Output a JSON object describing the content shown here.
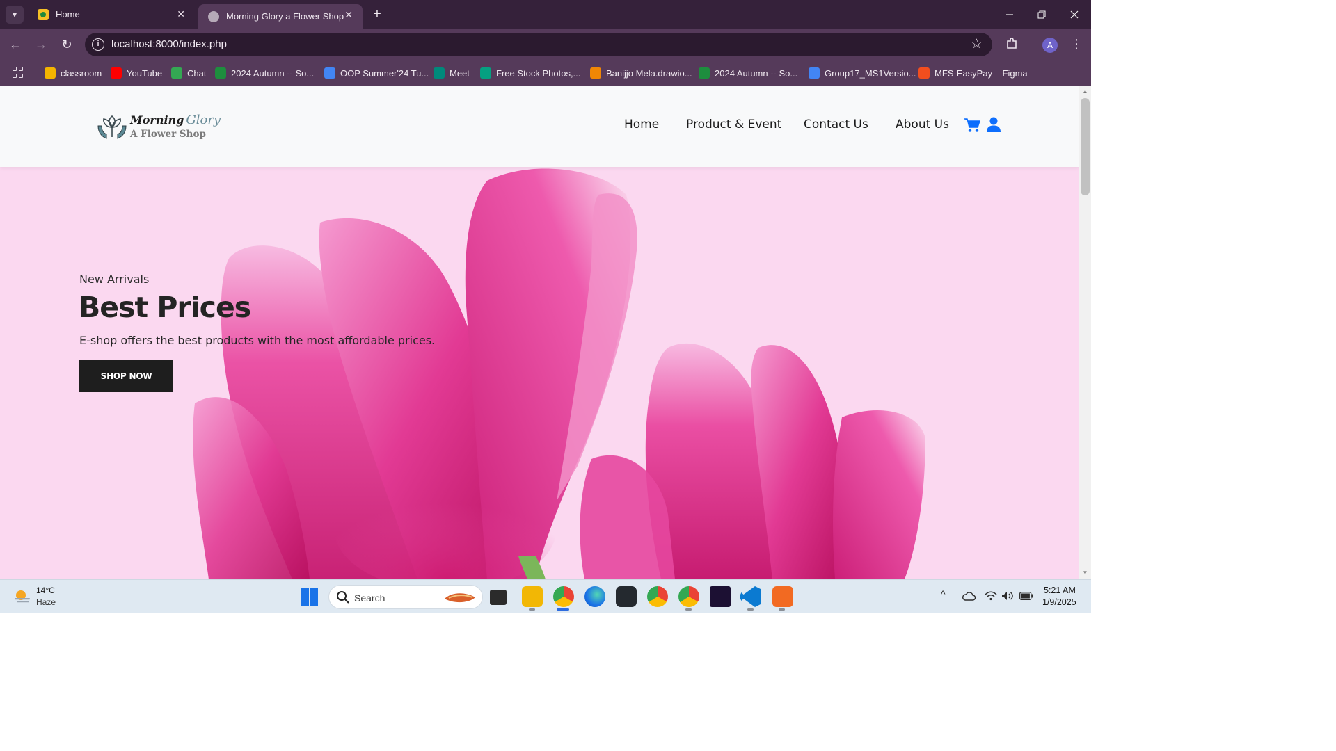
{
  "browser": {
    "tabs": [
      {
        "title": "Home",
        "active": false
      },
      {
        "title": "Morning Glory a Flower Shop",
        "active": true
      }
    ],
    "url": "localhost:8000/index.php",
    "profile_initial": "A",
    "bookmarks": [
      {
        "label": "classroom",
        "icon": "classroom-icon",
        "color": "#f4b400"
      },
      {
        "label": "YouTube",
        "icon": "youtube-icon",
        "color": "#ff0000"
      },
      {
        "label": "Chat",
        "icon": "google-chat-icon",
        "color": "#34a853"
      },
      {
        "label": "2024 Autumn -- So...",
        "icon": "google-sheets-icon",
        "color": "#1e8e3e"
      },
      {
        "label": "OOP Summer'24 Tu...",
        "icon": "google-drive-icon",
        "color": "#4285f4"
      },
      {
        "label": "Meet",
        "icon": "google-meet-icon",
        "color": "#00897b"
      },
      {
        "label": "Free Stock Photos,...",
        "icon": "pexels-icon",
        "color": "#05a081"
      },
      {
        "label": "Banijjo Mela.drawio...",
        "icon": "drawio-icon",
        "color": "#f08705"
      },
      {
        "label": "2024 Autumn -- So...",
        "icon": "google-sheets-icon",
        "color": "#1e8e3e"
      },
      {
        "label": "Group17_MS1Versio...",
        "icon": "google-docs-icon",
        "color": "#4285f4"
      },
      {
        "label": "MFS-EasyPay – Figma",
        "icon": "figma-icon",
        "color": "#f24e1e"
      }
    ]
  },
  "site": {
    "logo": {
      "line1": "Morning",
      "line1b": "Glory",
      "line2": "A Flower Shop"
    },
    "nav": {
      "home": "Home",
      "products": "Product & Event",
      "contact": "Contact Us",
      "about": "About Us"
    },
    "hero": {
      "kicker": "New Arrivals",
      "title": "Best Prices",
      "subtitle": "E-shop offers the best products with the most affordable prices.",
      "cta": "SHOP NOW"
    },
    "colors": {
      "accent": "#0d6efd",
      "hero_bg": "#fbd8f0",
      "button": "#1e1e1e"
    }
  },
  "taskbar": {
    "weather": {
      "temp": "14°C",
      "condition": "Haze"
    },
    "search_placeholder": "Search",
    "time": "5:21 AM",
    "date": "1/9/2025"
  }
}
